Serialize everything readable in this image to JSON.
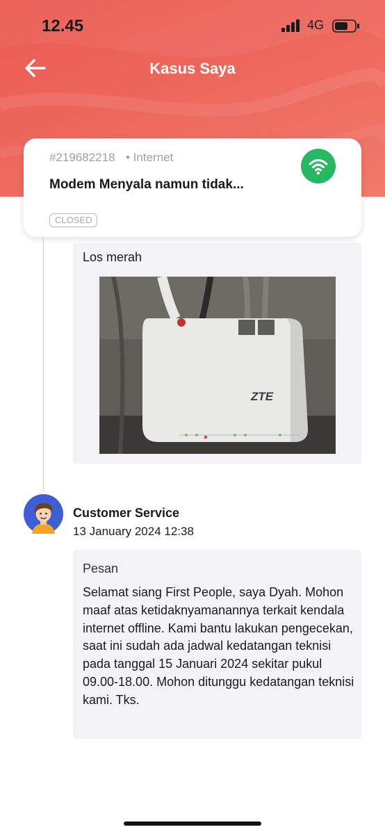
{
  "status_bar": {
    "time": "12.45",
    "network": "4G"
  },
  "header": {
    "title": "Kasus Saya"
  },
  "case": {
    "id": "#219682218",
    "category": "• Internet",
    "title": "Modem Menyala namun tidak...",
    "status": "CLOSED",
    "icon": "wifi-icon",
    "icon_color": "#28b863"
  },
  "messages": [
    {
      "text": "Los merah",
      "photo": "zte-modem-photo",
      "photo_text": "ZTE"
    },
    {
      "sender": "Customer Service",
      "datetime": "13 January 2024 12:38",
      "label": "Pesan",
      "body": "Selamat siang First People, saya Dyah. Mohon maaf atas ketidaknyamanannya terkait kendala internet offline. Kami bantu lakukan pengecekan, saat ini sudah ada jadwal kedatangan teknisi pada tanggal 15 Januari 2024 sekitar pukul 09.00-18.00. Mohon ditunggu kedatangan teknisi kami. Tks."
    }
  ],
  "colors": {
    "header_start": "#ea5a52",
    "header_end": "#f17a6c",
    "message_bg": "#f3f2f7"
  }
}
